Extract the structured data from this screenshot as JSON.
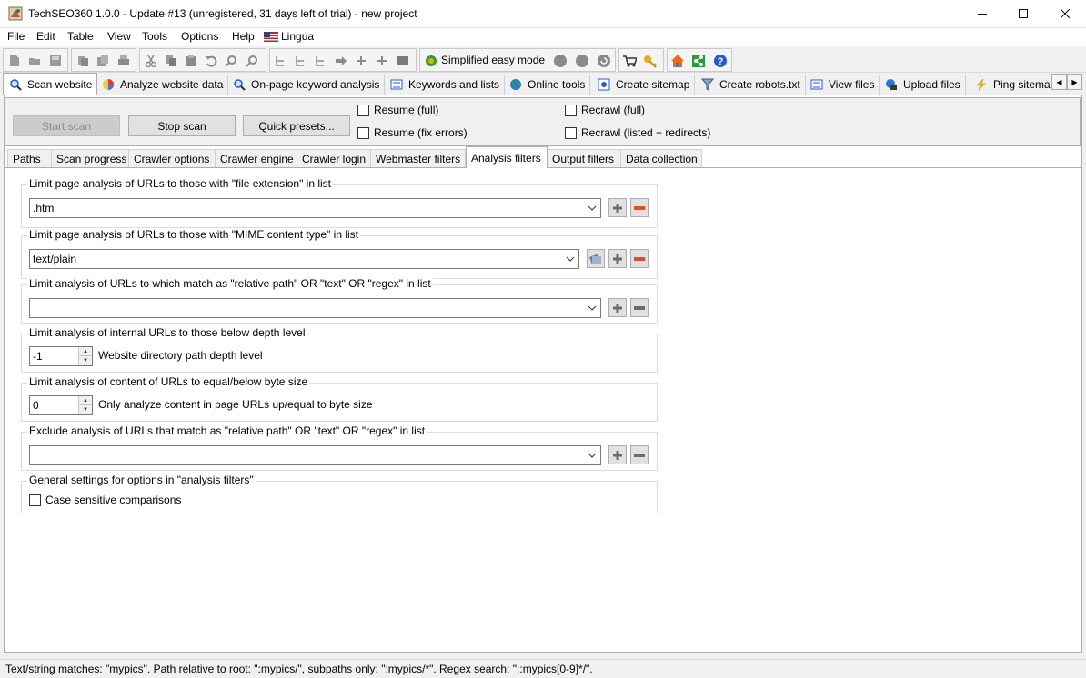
{
  "window": {
    "title": "TechSEO360 1.0.0 - Update #13 (unregistered, 31 days left of trial) - new project",
    "controls": [
      "minimize-icon",
      "maximize-icon",
      "close-icon"
    ]
  },
  "menu": [
    "File",
    "Edit",
    "Table",
    "View",
    "Tools",
    "Options",
    "Help",
    "Lingua"
  ],
  "toolbar": {
    "simplified_mode_label": "Simplified easy mode"
  },
  "main_tabs": [
    {
      "label": "Scan website",
      "icon": "magnifier-icon",
      "active": true
    },
    {
      "label": "Analyze website data",
      "icon": "pie-chart-icon"
    },
    {
      "label": "On-page keyword analysis",
      "icon": "magnifier-icon"
    },
    {
      "label": "Keywords and lists",
      "icon": "list-icon"
    },
    {
      "label": "Online tools",
      "icon": "globe-icon"
    },
    {
      "label": "Create sitemap",
      "icon": "sitemap-icon"
    },
    {
      "label": "Create robots.txt",
      "icon": "filter-icon"
    },
    {
      "label": "View files",
      "icon": "list-icon"
    },
    {
      "label": "Upload files",
      "icon": "upload-icon"
    },
    {
      "label": "Ping sitema",
      "icon": "lightning-icon"
    }
  ],
  "scan": {
    "start_label": "Start scan",
    "stop_label": "Stop scan",
    "presets_label": "Quick presets...",
    "resume_full": "Resume (full)",
    "resume_fix": "Resume (fix errors)",
    "recrawl_full": "Recrawl (full)",
    "recrawl_listed": "Recrawl (listed + redirects)"
  },
  "sub_tabs": [
    {
      "label": "Paths"
    },
    {
      "label": "Scan progress"
    },
    {
      "label": "Crawler options"
    },
    {
      "label": "Crawler engine"
    },
    {
      "label": "Crawler login"
    },
    {
      "label": "Webmaster filters"
    },
    {
      "label": "Analysis filters",
      "active": true
    },
    {
      "label": "Output filters"
    },
    {
      "label": "Data collection"
    }
  ],
  "filters": {
    "ext_title": "Limit page analysis of URLs to those with \"file extension\" in list",
    "ext_value": ".htm",
    "mime_title": "Limit page analysis of URLs to those with \"MIME content type\" in list",
    "mime_value": "text/plain",
    "match_title": "Limit analysis of URLs to which match as \"relative path\" OR \"text\" OR \"regex\" in list",
    "match_value": "",
    "depth_title": "Limit analysis of internal URLs to those below depth level",
    "depth_value": "-1",
    "depth_label": "Website directory path depth level",
    "size_title": "Limit analysis of content of URLs to equal/below byte size",
    "size_value": "0",
    "size_label": "Only analyze content in page URLs up/equal to byte size",
    "exclude_title": "Exclude analysis of URLs that match as \"relative path\" OR \"text\" OR \"regex\" in list",
    "exclude_value": "",
    "general_title": "General settings for options in \"analysis filters\"",
    "case_label": "Case sensitive comparisons"
  },
  "status": {
    "text": "Text/string matches: \"mypics\". Path relative to root: \":mypics/\", subpaths only: \":mypics/*\". Regex search: \"::mypics[0-9]*/\"."
  },
  "colors": {
    "accent_red": "#e24c1c",
    "plus_gray": "#6b6b6b"
  }
}
